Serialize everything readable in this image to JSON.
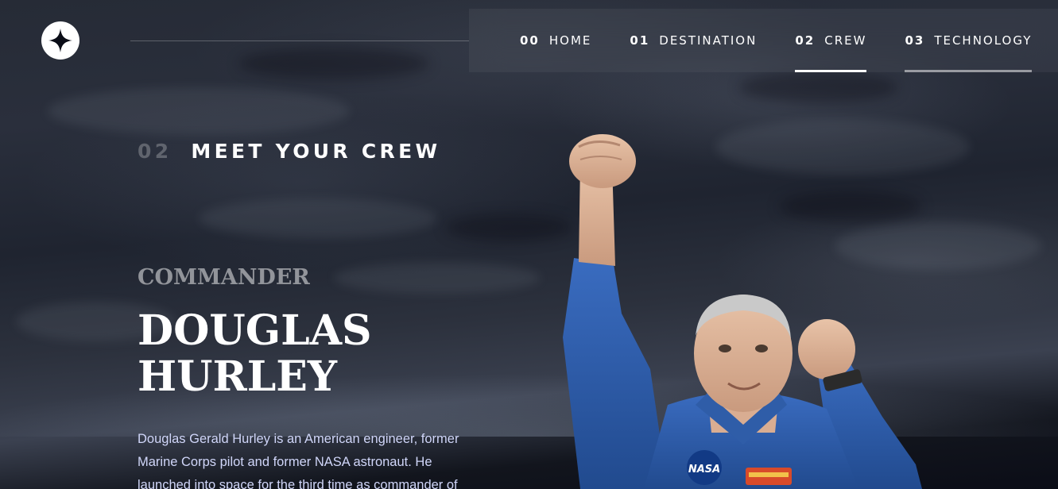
{
  "nav": {
    "items": [
      {
        "num": "00",
        "label": "HOME"
      },
      {
        "num": "01",
        "label": "DESTINATION"
      },
      {
        "num": "02",
        "label": "CREW"
      },
      {
        "num": "03",
        "label": "TECHNOLOGY"
      }
    ]
  },
  "page": {
    "eyebrow_num": "02",
    "eyebrow_text": "MEET YOUR CREW"
  },
  "crew": {
    "role": "Commander",
    "name": "Douglas Hurley",
    "bio": "Douglas Gerald Hurley is an American engineer, former Marine Corps pilot and former NASA astronaut. He launched into space for the third time as commander of"
  },
  "colors": {
    "background": "#0b0d17",
    "body_text": "#d0d6f9",
    "white": "#ffffff",
    "suit_blue": "#2a5aa8"
  },
  "icons": {
    "logo": "four-point-star-logo"
  }
}
